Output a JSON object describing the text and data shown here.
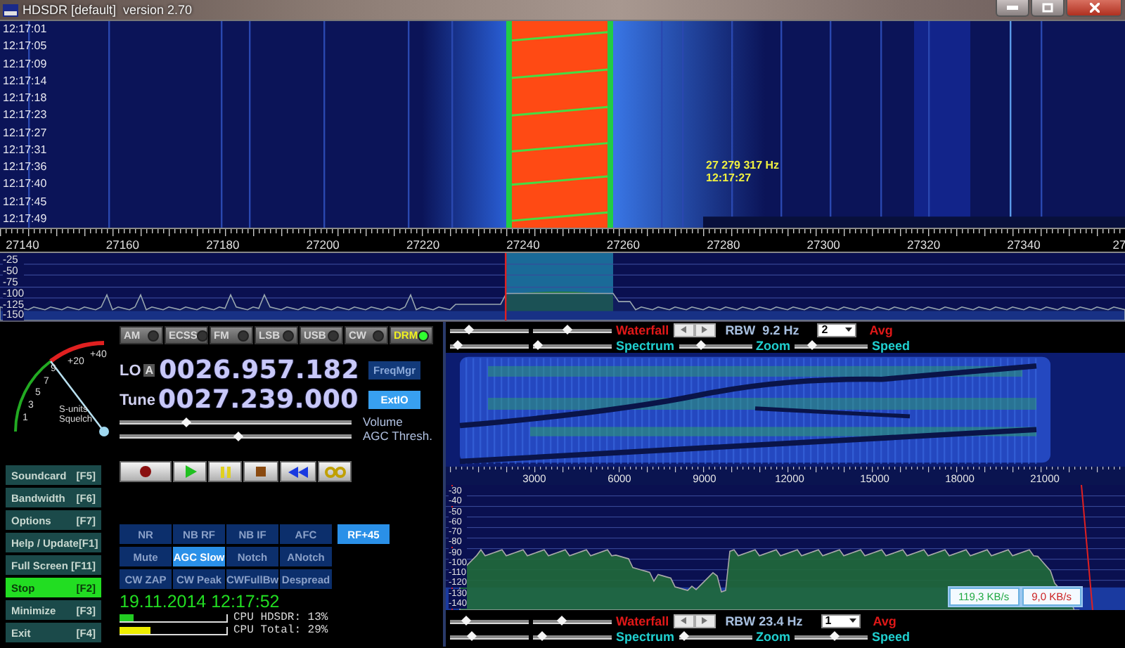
{
  "window": {
    "title": "HDSDR [default]  version 2.70"
  },
  "waterfall": {
    "times": [
      "12:17:01",
      "12:17:05",
      "12:17:09",
      "12:17:14",
      "12:17:18",
      "12:17:23",
      "12:17:27",
      "12:17:31",
      "12:17:36",
      "12:17:40",
      "12:17:45",
      "12:17:49"
    ],
    "marker": {
      "frequency": "27 279 317 Hz",
      "time": "12:17:27"
    }
  },
  "frequency_axis": [
    "27140",
    "27160",
    "27180",
    "27200",
    "27220",
    "27240",
    "27260",
    "27280",
    "27300",
    "27320",
    "27340",
    "27"
  ],
  "spectrum": {
    "db_labels": [
      "-25",
      "-50",
      "-75",
      "-100",
      "-125",
      "-150"
    ]
  },
  "s_meter": {
    "scale": [
      "1",
      "3",
      "5",
      "7",
      "9",
      "+20",
      "+40"
    ],
    "label": "S-units",
    "squelch_label": "Squelch"
  },
  "modes": [
    {
      "label": "AM",
      "selected": false
    },
    {
      "label": "ECSS",
      "selected": false
    },
    {
      "label": "FM",
      "selected": false
    },
    {
      "label": "LSB",
      "selected": false
    },
    {
      "label": "USB",
      "selected": false
    },
    {
      "label": "CW",
      "selected": false
    },
    {
      "label": "DRM",
      "selected": true
    }
  ],
  "lo": {
    "label": "LO",
    "vfo": "A",
    "value": "0026.957.182"
  },
  "tune": {
    "label": "Tune",
    "value": "0027.239.000"
  },
  "side_buttons": [
    {
      "label": "FreqMgr",
      "selected": false
    },
    {
      "label": "ExtIO",
      "selected": true
    }
  ],
  "level_sliders": [
    {
      "label": "Volume",
      "level": 0.28
    },
    {
      "label": "AGC Thresh.",
      "level": 0.51
    }
  ],
  "transport": [
    {
      "kind": "record"
    },
    {
      "kind": "play"
    },
    {
      "kind": "pause"
    },
    {
      "kind": "stop"
    },
    {
      "kind": "rewind"
    },
    {
      "kind": "loop"
    }
  ],
  "function_keys": [
    {
      "label": "Soundcard",
      "key": "[F5]",
      "selected": false
    },
    {
      "label": "Bandwidth",
      "key": "[F6]",
      "selected": false
    },
    {
      "label": "Options",
      "key": "[F7]",
      "selected": false
    },
    {
      "label": "Help / Update",
      "key": "[F1]",
      "selected": false
    },
    {
      "label": "Full Screen",
      "key": "[F11]",
      "selected": false
    },
    {
      "label": "Stop",
      "key": "[F2]",
      "selected": true
    },
    {
      "label": "Minimize",
      "key": "[F3]",
      "selected": false
    },
    {
      "label": "Exit",
      "key": "[F4]",
      "selected": false
    }
  ],
  "dsp_rows": [
    {
      "buttons": [
        {
          "label": "NR",
          "selected": false
        },
        {
          "label": "NB RF",
          "selected": false
        },
        {
          "label": "NB IF",
          "selected": false
        },
        {
          "label": "AFC",
          "selected": false
        },
        {
          "label": "RF+45",
          "selected": true
        }
      ]
    },
    {
      "buttons": [
        {
          "label": "Mute",
          "selected": false
        },
        {
          "label": "AGC Slow",
          "selected": true
        },
        {
          "label": "Notch",
          "selected": false
        },
        {
          "label": "ANotch",
          "selected": false
        }
      ]
    },
    {
      "buttons": [
        {
          "label": "CW ZAP",
          "selected": false
        },
        {
          "label": "CW Peak",
          "selected": false
        },
        {
          "label": "CWFullBw",
          "selected": false
        },
        {
          "label": "Despread",
          "selected": false
        }
      ]
    }
  ],
  "clock": "19.11.2014 12:17:52",
  "cpu": [
    {
      "label": "CPU HDSDR: 13%",
      "level": 0.13,
      "color": "#22cc22"
    },
    {
      "label": "CPU Total: 29%",
      "level": 0.29,
      "color": "#eeee00"
    }
  ],
  "audio_controls": [
    {
      "waterfall_label": "Waterfall",
      "rbw": "RBW  9.2 Hz",
      "avg_value": "2",
      "avg_label": "Avg",
      "spectrum_label": "Spectrum",
      "zoom_label": "Zoom",
      "speed_label": "Speed",
      "sliders": [
        {
          "level": 0.2
        },
        {
          "level": 0.42
        },
        {
          "level": 0.05
        },
        {
          "level": 0.0
        },
        {
          "level": 0.27
        },
        {
          "level": 0.2
        }
      ]
    },
    {
      "waterfall_label": "Waterfall",
      "rbw": "RBW 23.4 Hz",
      "avg_value": "1",
      "avg_label": "Avg",
      "spectrum_label": "Spectrum",
      "zoom_label": "Zoom",
      "speed_label": "Speed",
      "sliders": [
        {
          "level": 0.16
        },
        {
          "level": 0.35
        },
        {
          "level": 0.25
        },
        {
          "level": 0.07
        },
        {
          "level": 0.0
        },
        {
          "level": 0.55
        }
      ]
    }
  ],
  "audio_axis": [
    "3000",
    "6000",
    "9000",
    "12000",
    "15000",
    "18000",
    "21000"
  ],
  "audio_db_labels": [
    "-30",
    "-40",
    "-50",
    "-60",
    "-70",
    "-80",
    "-90",
    "-100",
    "-110",
    "-120",
    "-130",
    "-140"
  ],
  "rates": [
    {
      "text": "119,3 KB/s",
      "color": "#22aa44"
    },
    {
      "text": "9,0 KB/s",
      "color": "#cc2222"
    }
  ]
}
